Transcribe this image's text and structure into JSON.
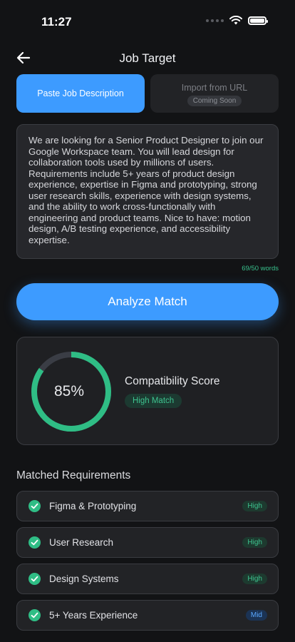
{
  "status_bar": {
    "time": "11:27"
  },
  "nav": {
    "title": "Job Target"
  },
  "tabs": {
    "paste": "Paste Job Description",
    "import": "Import from URL",
    "import_badge": "Coming Soon"
  },
  "job_description": "We are looking for a Senior Product Designer to join our Google Workspace team. You will lead design for collaboration tools used by millions of users. Requirements include 5+ years of product design experience, expertise in Figma and prototyping, strong user research skills, experience with design systems, and the ability to work cross-functionally with engineering and product teams. Nice to have: motion design, A/B testing experience, and accessibility expertise.",
  "word_count": "69/50 words",
  "analyze_label": "Analyze Match",
  "score": {
    "percent_text": "85%",
    "percent": 0.85,
    "label": "Compatibility Score",
    "badge": "High Match"
  },
  "requirements_title": "Matched Requirements",
  "requirements": [
    {
      "label": "Figma & Prototyping",
      "level": "High"
    },
    {
      "label": "User Research",
      "level": "High"
    },
    {
      "label": "Design Systems",
      "level": "High"
    },
    {
      "label": "5+ Years Experience",
      "level": "Mid"
    }
  ],
  "colors": {
    "accent": "#3d9bff",
    "success": "#2fbd85",
    "background": "#121315"
  },
  "icons": {
    "back": "arrow-left-icon",
    "check": "check-circle-icon",
    "wifi": "wifi-icon",
    "battery": "battery-icon"
  }
}
